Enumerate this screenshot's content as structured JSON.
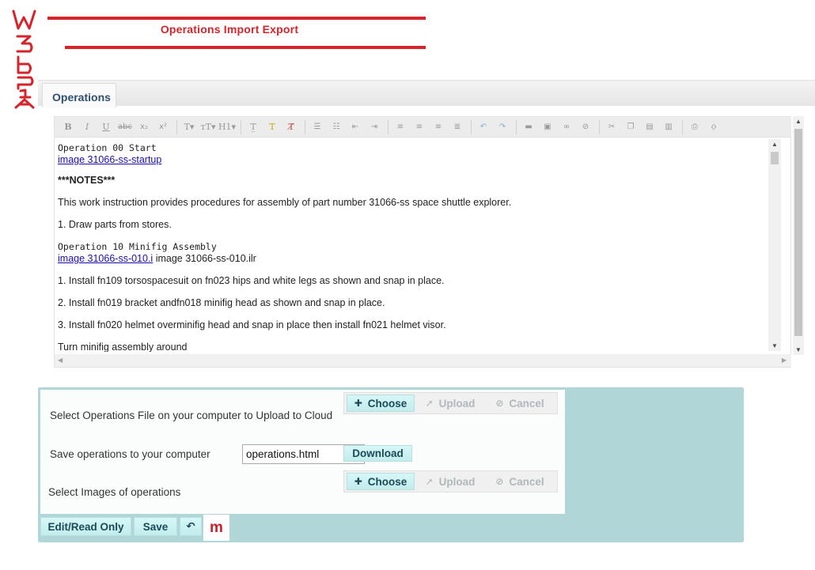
{
  "logo": {
    "text": "W3bP1A"
  },
  "header": {
    "title": "Operations Import Export"
  },
  "tabs": [
    {
      "label": "Operations"
    }
  ],
  "toolbar": {
    "icons": [
      "bold-icon",
      "italic-icon",
      "underline-icon",
      "strikethrough-icon",
      "subscript-icon",
      "superscript-icon",
      "font-icon",
      "font-size-icon",
      "heading-icon",
      "clear-format-icon",
      "text-color-icon",
      "remove-format-icon",
      "bullet-list-icon",
      "numbered-list-icon",
      "outdent-icon",
      "indent-icon",
      "align-left-icon",
      "align-center-icon",
      "align-right-icon",
      "justify-icon",
      "undo-icon",
      "redo-icon",
      "horizontal-rule-icon",
      "insert-image-icon",
      "insert-link-icon",
      "unlink-icon",
      "cut-icon",
      "copy-icon",
      "paste-icon",
      "paste-text-icon",
      "print-icon",
      "source-icon"
    ]
  },
  "editor": {
    "op00_title": "Operation 00 Start",
    "op00_link": "image 31066-ss-startup",
    "notes_label": "***NOTES***",
    "intro": "This work instruction provides procedures for assembly of part number 31066-ss space shuttle explorer.",
    "step_draw": "1. Draw parts from stores.",
    "op10_title": "Operation 10 Minifig Assembly",
    "op10_link": "image 31066-ss-010.i",
    "op10_text": " image 31066-ss-010.ilr",
    "step1": "1. Install fn109 torsospacesuit on fn023 hips and white legs as shown and snap in place.",
    "step2": "2. Install fn019 bracket andfn018 minifig head as shown and snap in place.",
    "step3": "3. Install fn020 helmet overminifig head and snap in place then install fn021 helmet visor.",
    "step4": "Turn minifig assembly around"
  },
  "panel": {
    "upload_ops_label": "Select Operations File on your computer to Upload to Cloud",
    "save_ops_label": "Save operations to your computer",
    "filename_value": "operations.html",
    "download_label": "Download",
    "images_label": "Select Images of operations",
    "choose_label": "Choose",
    "upload_label": "Upload",
    "cancel_label": "Cancel",
    "edit_label": "Edit/Read Only",
    "save_label": "Save",
    "undo_label": "↶",
    "m_label": "m"
  },
  "colors": {
    "brand_red": "#d8232a",
    "panel_teal": "#b1d6d8",
    "button_cyan": "#c2ecec"
  }
}
